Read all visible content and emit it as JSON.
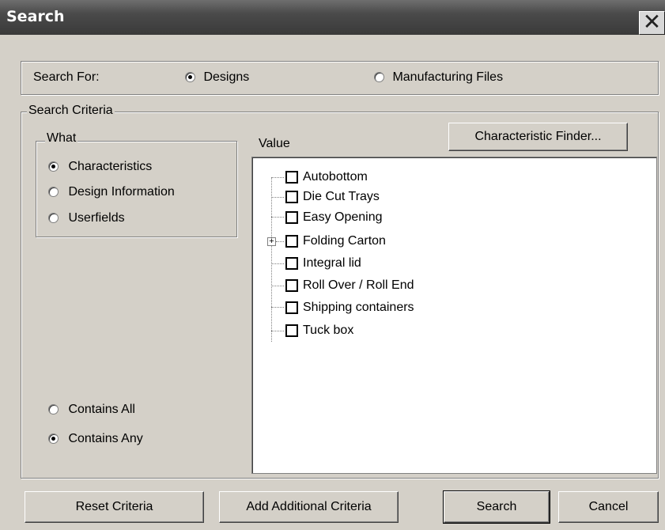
{
  "window": {
    "title": "Search",
    "close_glyph": "✕"
  },
  "search_for": {
    "label": "Search For:",
    "options": [
      "Designs",
      "Manufacturing Files"
    ],
    "selected": "Designs"
  },
  "criteria": {
    "group_label": "Search Criteria",
    "what": {
      "group_label": "What",
      "options": [
        "Characteristics",
        "Design Information",
        "Userfields"
      ],
      "selected": "Characteristics"
    },
    "value_label": "Value",
    "finder_button": "Characteristic Finder...",
    "tree_items": [
      "Autobottom",
      "Die Cut Trays",
      "Easy Opening",
      "Folding Carton",
      "Integral lid",
      "Roll Over / Roll End",
      "Shipping containers",
      "Tuck box"
    ],
    "expandable_item": "Folding Carton",
    "expander_glyph": "+",
    "match": {
      "options": [
        "Contains All",
        "Contains Any"
      ],
      "selected": "Contains Any"
    }
  },
  "buttons": {
    "reset": "Reset Criteria",
    "add": "Add Additional Criteria",
    "search": "Search",
    "cancel": "Cancel"
  },
  "colors": {
    "dialog_bg": "#d4d0c8",
    "titlebar": "#4a4a4a",
    "title_text": "#ffffff"
  },
  "icons": {
    "close": "close-icon",
    "tree_expander": "plus-expander-icon"
  }
}
